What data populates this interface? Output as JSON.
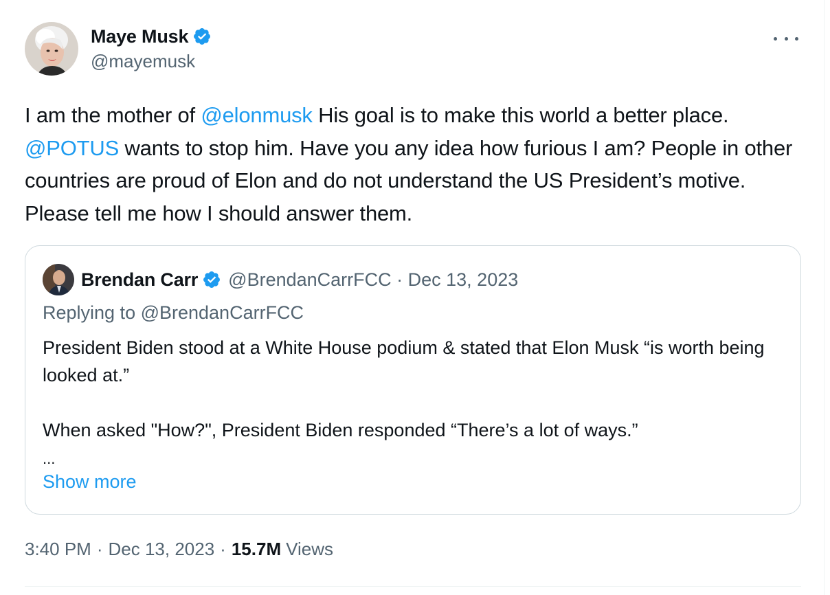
{
  "tweet": {
    "author": {
      "name": "Maye Musk",
      "handle": "@mayemusk"
    },
    "text_parts": [
      "I am the mother of ",
      "@elonmusk",
      " His goal is to make this world a better place. ",
      "@POTUS",
      " wants to stop him. Have you any idea how furious I am? People in other countries are proud of Elon and do not understand the US President’s motive. Please tell me how I should answer them."
    ],
    "time": "3:40 PM",
    "date": "Dec 13, 2023",
    "separator": "·",
    "views_count": "15.7M",
    "views_label": "Views"
  },
  "quote": {
    "author": {
      "name": "Brendan Carr",
      "handle": "@BrendanCarrFCC · Dec 13, 2023"
    },
    "replying_to": "Replying to @BrendanCarrFCC",
    "paragraph1": "President Biden stood at a White House podium & stated that Elon Musk “is worth being looked at.”",
    "paragraph2": "When asked \"How?\", President Biden responded “There’s a lot of ways.”",
    "ellipsis": "...",
    "show_more": "Show more"
  },
  "icons": {
    "verified": "verified-badge-icon",
    "more": "more-options-icon"
  },
  "colors": {
    "accent": "#1d9bf0",
    "text": "#0f1419",
    "secondary": "#536471",
    "border": "#cfd9de"
  }
}
